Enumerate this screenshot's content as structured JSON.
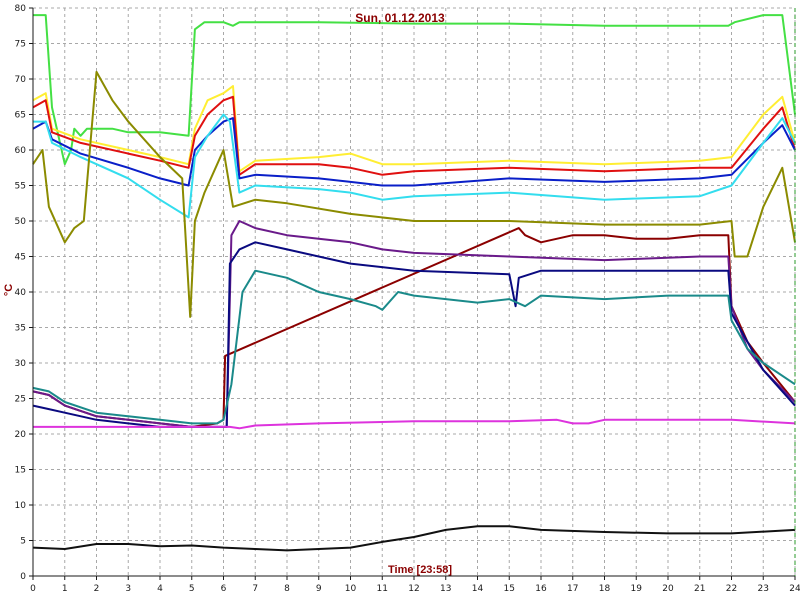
{
  "chart_data": {
    "type": "line",
    "title": "Sun, 01.12.2013",
    "xlabel": "Time [23:58]",
    "ylabel": "°C",
    "xlim": [
      0,
      24
    ],
    "ylim": [
      0,
      80
    ],
    "x_ticks": [
      0,
      1,
      2,
      3,
      4,
      5,
      6,
      7,
      8,
      9,
      10,
      11,
      12,
      13,
      14,
      15,
      16,
      17,
      18,
      19,
      20,
      21,
      22,
      23,
      24
    ],
    "y_ticks": [
      0,
      5,
      10,
      15,
      20,
      25,
      30,
      35,
      40,
      45,
      50,
      55,
      60,
      65,
      70,
      75,
      80
    ],
    "grid": true,
    "colors": {
      "title": "#8b0000",
      "xlabel": "#8b0000",
      "ylabel": "#8b0000",
      "grid": "#a8a8a8",
      "axis": "#1a1a1a"
    },
    "series": [
      {
        "color": "#44e044",
        "points": [
          [
            0,
            79
          ],
          [
            0.4,
            79
          ],
          [
            0.6,
            66
          ],
          [
            1.0,
            58
          ],
          [
            1.2,
            60
          ],
          [
            1.3,
            63
          ],
          [
            1.5,
            62
          ],
          [
            1.7,
            63
          ],
          [
            2,
            63
          ],
          [
            2.5,
            63
          ],
          [
            3,
            62.5
          ],
          [
            4,
            62.5
          ],
          [
            4.9,
            62
          ],
          [
            5.1,
            77
          ],
          [
            5.4,
            78
          ],
          [
            6.0,
            78
          ],
          [
            6.3,
            77.5
          ],
          [
            6.5,
            78
          ],
          [
            7,
            78
          ],
          [
            9,
            78
          ],
          [
            12,
            77.8
          ],
          [
            15,
            77.8
          ],
          [
            18,
            77.5
          ],
          [
            21,
            77.5
          ],
          [
            21.9,
            77.5
          ],
          [
            22.1,
            78
          ],
          [
            23,
            79
          ],
          [
            23.6,
            79
          ],
          [
            24,
            65
          ]
        ]
      },
      {
        "color": "#ffee33",
        "points": [
          [
            0,
            67
          ],
          [
            0.4,
            68
          ],
          [
            0.6,
            63
          ],
          [
            1.5,
            61.5
          ],
          [
            3,
            60
          ],
          [
            4,
            59
          ],
          [
            4.9,
            58
          ],
          [
            5.1,
            63
          ],
          [
            5.5,
            67
          ],
          [
            6.0,
            68
          ],
          [
            6.3,
            69
          ],
          [
            6.5,
            57
          ],
          [
            7,
            58.5
          ],
          [
            9,
            59
          ],
          [
            10,
            59.5
          ],
          [
            11,
            58
          ],
          [
            12,
            58
          ],
          [
            15,
            58.5
          ],
          [
            18,
            58
          ],
          [
            21,
            58.5
          ],
          [
            22,
            59
          ],
          [
            23,
            65
          ],
          [
            23.6,
            67.5
          ],
          [
            24,
            61
          ]
        ]
      },
      {
        "color": "#e01010",
        "points": [
          [
            0,
            66
          ],
          [
            0.4,
            67
          ],
          [
            0.6,
            62.5
          ],
          [
            1.5,
            61
          ],
          [
            3,
            59.5
          ],
          [
            4,
            58.5
          ],
          [
            4.9,
            57.5
          ],
          [
            5.1,
            62
          ],
          [
            5.5,
            65
          ],
          [
            6.0,
            67
          ],
          [
            6.3,
            67.5
          ],
          [
            6.5,
            56.5
          ],
          [
            7,
            58
          ],
          [
            9,
            58
          ],
          [
            10,
            57.5
          ],
          [
            11,
            56.5
          ],
          [
            12,
            57
          ],
          [
            15,
            57.5
          ],
          [
            18,
            57
          ],
          [
            21,
            57.5
          ],
          [
            22,
            57.5
          ],
          [
            23,
            63
          ],
          [
            23.6,
            66
          ],
          [
            24,
            60
          ]
        ]
      },
      {
        "color": "#0a1fc8",
        "points": [
          [
            0,
            63
          ],
          [
            0.4,
            64
          ],
          [
            0.6,
            61.5
          ],
          [
            1.5,
            59.5
          ],
          [
            3,
            57.5
          ],
          [
            4,
            56
          ],
          [
            4.9,
            55
          ],
          [
            5.1,
            60
          ],
          [
            5.5,
            62
          ],
          [
            6.0,
            64
          ],
          [
            6.3,
            64.5
          ],
          [
            6.5,
            56
          ],
          [
            7,
            56.5
          ],
          [
            9,
            56
          ],
          [
            10,
            55.5
          ],
          [
            11,
            55
          ],
          [
            12,
            55
          ],
          [
            15,
            56
          ],
          [
            18,
            55.5
          ],
          [
            21,
            56
          ],
          [
            22,
            56.5
          ],
          [
            23,
            61
          ],
          [
            23.6,
            63.5
          ],
          [
            24,
            60
          ]
        ]
      },
      {
        "color": "#33ddee",
        "points": [
          [
            0,
            64
          ],
          [
            0.4,
            64
          ],
          [
            0.6,
            61
          ],
          [
            1.5,
            59
          ],
          [
            3,
            56
          ],
          [
            4,
            53
          ],
          [
            4.9,
            50.5
          ],
          [
            5.1,
            59
          ],
          [
            5.5,
            62
          ],
          [
            6.0,
            65
          ],
          [
            6.2,
            64
          ],
          [
            6.5,
            54
          ],
          [
            7,
            55
          ],
          [
            9,
            54.5
          ],
          [
            10,
            54
          ],
          [
            11,
            53
          ],
          [
            12,
            53.5
          ],
          [
            15,
            54
          ],
          [
            18,
            53
          ],
          [
            21,
            53.5
          ],
          [
            22,
            55
          ],
          [
            23,
            61
          ],
          [
            23.6,
            64.5
          ],
          [
            24,
            61
          ]
        ]
      },
      {
        "color": "#8b8b00",
        "points": [
          [
            0,
            58
          ],
          [
            0.3,
            60
          ],
          [
            0.5,
            52
          ],
          [
            1.0,
            47
          ],
          [
            1.3,
            49
          ],
          [
            1.6,
            50
          ],
          [
            2,
            71
          ],
          [
            2.5,
            67
          ],
          [
            3,
            64
          ],
          [
            4,
            59
          ],
          [
            4.7,
            56
          ],
          [
            4.95,
            36.5
          ],
          [
            5.1,
            50
          ],
          [
            5.4,
            54
          ],
          [
            5.8,
            58
          ],
          [
            6.0,
            60
          ],
          [
            6.3,
            52
          ],
          [
            7,
            53
          ],
          [
            8,
            52.5
          ],
          [
            10,
            51
          ],
          [
            12,
            50
          ],
          [
            15,
            50
          ],
          [
            18,
            49.5
          ],
          [
            21,
            49.5
          ],
          [
            22,
            50
          ],
          [
            22.1,
            45
          ],
          [
            22.5,
            45
          ],
          [
            23,
            52
          ],
          [
            23.6,
            57.5
          ],
          [
            24,
            47
          ]
        ]
      },
      {
        "color": "#8b0000",
        "points": [
          [
            0,
            26
          ],
          [
            0.5,
            25.5
          ],
          [
            1,
            24
          ],
          [
            2,
            22.5
          ],
          [
            3,
            22
          ],
          [
            4,
            21.5
          ],
          [
            5,
            21
          ],
          [
            5.8,
            21.5
          ],
          [
            6.0,
            22
          ],
          [
            6.05,
            31
          ],
          [
            15.3,
            49
          ],
          [
            15.5,
            48
          ],
          [
            16,
            47
          ],
          [
            17,
            48
          ],
          [
            18,
            48
          ],
          [
            19,
            47.5
          ],
          [
            20,
            47.5
          ],
          [
            21,
            48
          ],
          [
            21.9,
            48
          ],
          [
            22,
            38
          ],
          [
            22.5,
            33
          ],
          [
            23,
            30
          ],
          [
            24,
            24.5
          ]
        ]
      },
      {
        "color": "#6a1a8a",
        "points": [
          [
            0,
            26
          ],
          [
            0.5,
            25.5
          ],
          [
            1,
            24
          ],
          [
            2,
            22.5
          ],
          [
            3,
            22
          ],
          [
            4,
            21.5
          ],
          [
            5,
            21
          ],
          [
            5.8,
            21
          ],
          [
            6.1,
            21
          ],
          [
            6.25,
            48
          ],
          [
            6.5,
            50
          ],
          [
            7,
            49
          ],
          [
            8,
            48
          ],
          [
            10,
            47
          ],
          [
            11,
            46
          ],
          [
            12,
            45.5
          ],
          [
            15,
            45
          ],
          [
            18,
            44.5
          ],
          [
            21,
            45
          ],
          [
            21.9,
            45
          ],
          [
            22,
            38
          ],
          [
            22.5,
            32
          ],
          [
            23,
            29
          ],
          [
            24,
            24.5
          ]
        ]
      },
      {
        "color": "#0a0a80",
        "points": [
          [
            0,
            24
          ],
          [
            0.5,
            23.5
          ],
          [
            1,
            23
          ],
          [
            2,
            22
          ],
          [
            3,
            21.5
          ],
          [
            4,
            21
          ],
          [
            5,
            21
          ],
          [
            5.8,
            21
          ],
          [
            6.1,
            21
          ],
          [
            6.2,
            44
          ],
          [
            6.5,
            46
          ],
          [
            7,
            47
          ],
          [
            8,
            46
          ],
          [
            10,
            44
          ],
          [
            12,
            43
          ],
          [
            15,
            42.5
          ],
          [
            15.2,
            38
          ],
          [
            15.3,
            42
          ],
          [
            16,
            43
          ],
          [
            18,
            43
          ],
          [
            21,
            43
          ],
          [
            21.9,
            43
          ],
          [
            22,
            37
          ],
          [
            22.5,
            33
          ],
          [
            23,
            29
          ],
          [
            24,
            24
          ]
        ]
      },
      {
        "color": "#1a8a8a",
        "points": [
          [
            0,
            26.5
          ],
          [
            0.5,
            26
          ],
          [
            1,
            24.5
          ],
          [
            2,
            23
          ],
          [
            3,
            22.5
          ],
          [
            4,
            22
          ],
          [
            5,
            21.5
          ],
          [
            5.8,
            21.5
          ],
          [
            6.0,
            22
          ],
          [
            6.25,
            27
          ],
          [
            6.6,
            40
          ],
          [
            7,
            43
          ],
          [
            8,
            42
          ],
          [
            9,
            40
          ],
          [
            10,
            39
          ],
          [
            10.8,
            38
          ],
          [
            11,
            37.5
          ],
          [
            11.5,
            40
          ],
          [
            12,
            39.5
          ],
          [
            13,
            39
          ],
          [
            14,
            38.5
          ],
          [
            15,
            39
          ],
          [
            15.5,
            38
          ],
          [
            16,
            39.5
          ],
          [
            18,
            39
          ],
          [
            20,
            39.5
          ],
          [
            21.9,
            39.5
          ],
          [
            22,
            36
          ],
          [
            22.5,
            32
          ],
          [
            23,
            30
          ],
          [
            24,
            27
          ]
        ]
      },
      {
        "color": "#dd33dd",
        "points": [
          [
            0,
            21
          ],
          [
            1,
            21
          ],
          [
            3,
            21
          ],
          [
            5,
            21
          ],
          [
            6.2,
            21
          ],
          [
            6.5,
            20.8
          ],
          [
            7,
            21.2
          ],
          [
            9,
            21.5
          ],
          [
            12,
            21.8
          ],
          [
            15,
            21.8
          ],
          [
            16.5,
            22
          ],
          [
            17,
            21.5
          ],
          [
            17.5,
            21.5
          ],
          [
            18,
            22
          ],
          [
            21,
            22
          ],
          [
            22,
            22
          ],
          [
            24,
            21.5
          ]
        ]
      },
      {
        "color": "#111111",
        "points": [
          [
            0,
            4
          ],
          [
            1,
            3.8
          ],
          [
            2,
            4.5
          ],
          [
            3,
            4.5
          ],
          [
            4,
            4.2
          ],
          [
            5,
            4.3
          ],
          [
            6,
            4
          ],
          [
            7,
            3.8
          ],
          [
            8,
            3.6
          ],
          [
            9,
            3.8
          ],
          [
            10,
            4
          ],
          [
            11,
            4.8
          ],
          [
            12,
            5.5
          ],
          [
            13,
            6.5
          ],
          [
            14,
            7
          ],
          [
            15,
            7
          ],
          [
            16,
            6.5
          ],
          [
            18,
            6.2
          ],
          [
            20,
            6
          ],
          [
            22,
            6
          ],
          [
            24,
            6.5
          ]
        ]
      }
    ]
  }
}
